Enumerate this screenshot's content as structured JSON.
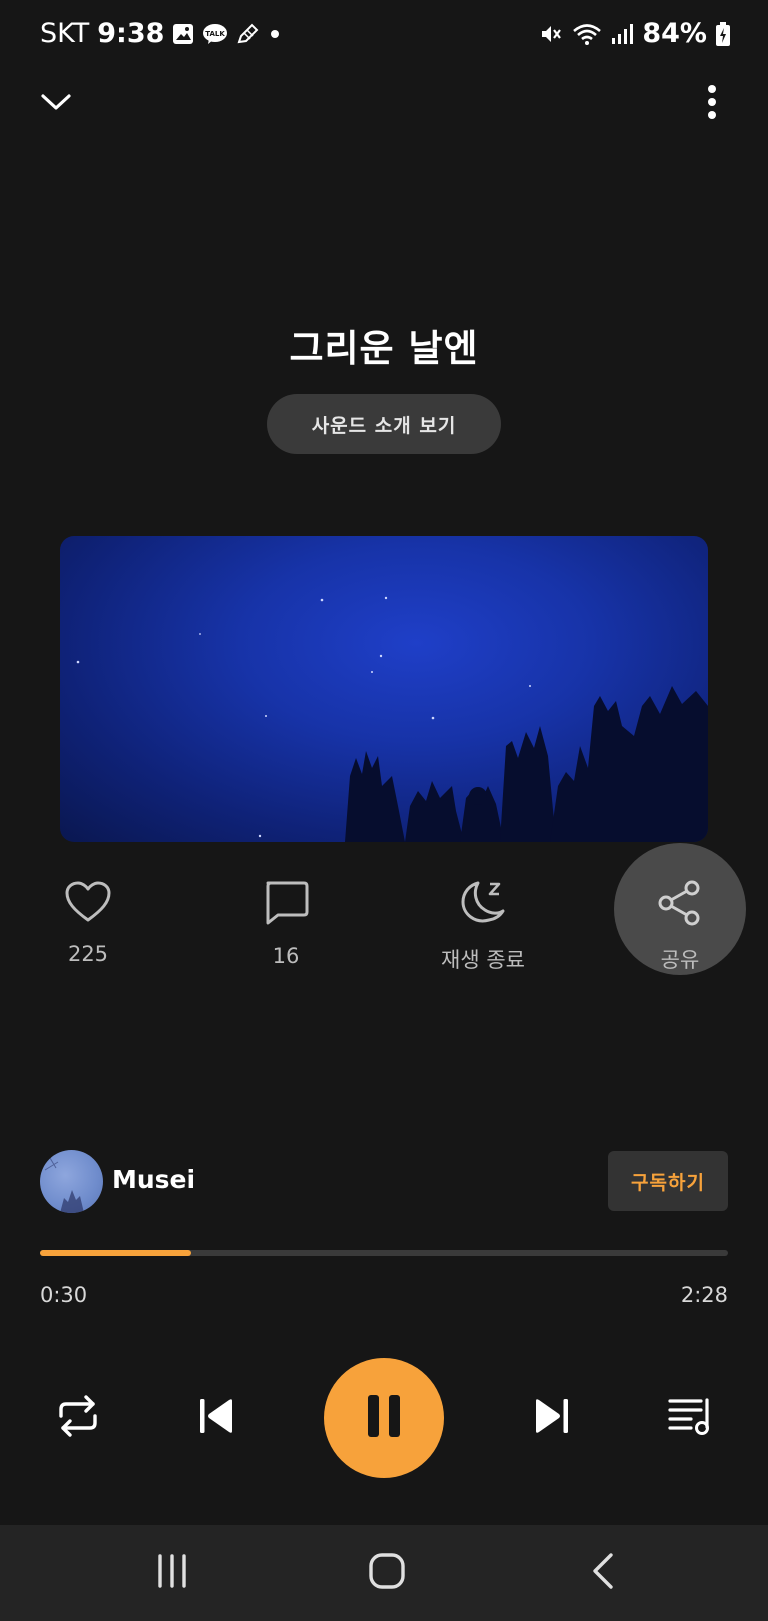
{
  "status_bar": {
    "carrier": "SKT",
    "time": "9:38",
    "notification_icons": [
      "gallery-icon",
      "kakaotalk-icon",
      "pencil-icon",
      "dot-icon"
    ],
    "system_icons": [
      "mute-icon",
      "wifi-icon",
      "signal-icon",
      "battery-charging-icon"
    ],
    "battery": "84%"
  },
  "top_bar": {
    "collapse_icon": "chevron-down-icon",
    "more_icon": "more-vertical-icon"
  },
  "track": {
    "title": "그리운 날엔",
    "intro_button": "사운드 소개 보기"
  },
  "actions": {
    "like": {
      "icon": "heart-icon",
      "label": "225"
    },
    "comment": {
      "icon": "comment-icon",
      "label": "16"
    },
    "sleep_timer": {
      "icon": "moon-icon",
      "label": "재생 종료"
    },
    "share": {
      "icon": "share-icon",
      "label": "공유"
    }
  },
  "channel": {
    "name": "Musei",
    "subscribe_label": "구독하기"
  },
  "playback": {
    "current_time": "0:30",
    "total_time": "2:28",
    "progress": 0.22
  },
  "controls": [
    "repeat-icon",
    "previous-icon",
    "pause-icon",
    "next-icon",
    "playlist-icon"
  ],
  "nav_bar": [
    "recents-icon",
    "home-icon",
    "back-icon"
  ],
  "colors": {
    "accent": "#f7a23b",
    "background": "#161616",
    "nav_background": "#242424"
  }
}
